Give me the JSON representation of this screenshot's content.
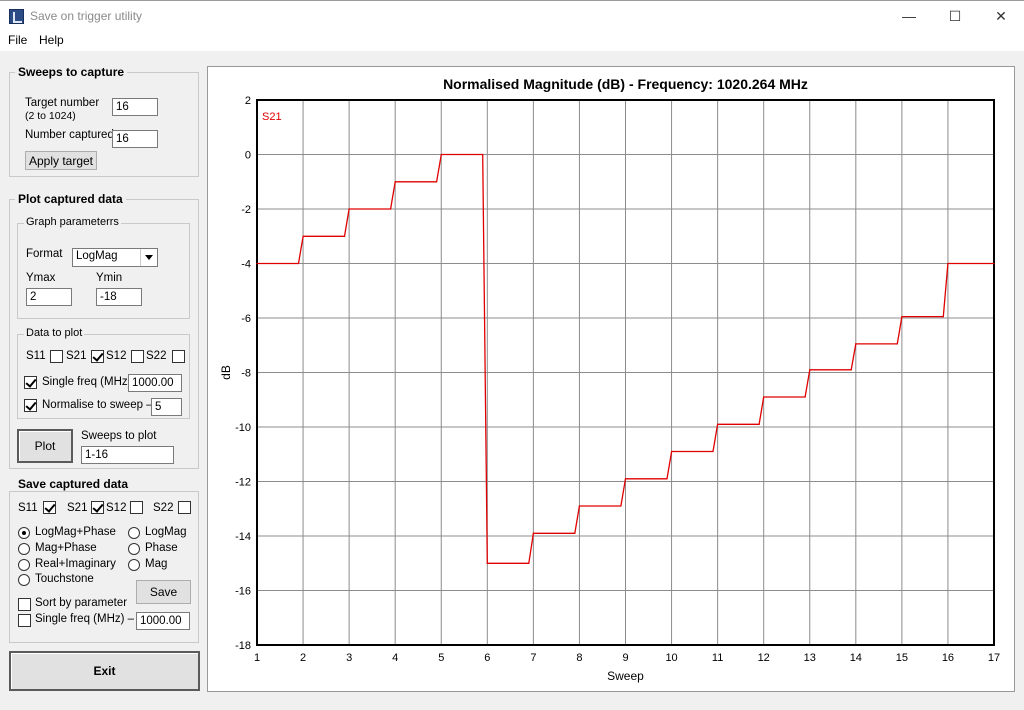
{
  "window": {
    "title": "Save on trigger utility",
    "minimize": "—",
    "maximize": "☐",
    "close": "✕"
  },
  "menu": {
    "file": "File",
    "help": "Help"
  },
  "sweeps": {
    "group_title": "Sweeps to capture",
    "target_label_1": "Target number",
    "target_label_2": "(2 to 1024)",
    "target_value": "16",
    "captured_label": "Number captured",
    "captured_value": "16",
    "apply_button": "Apply target"
  },
  "plot_group": {
    "title": "Plot captured data",
    "graph_params": "Graph parameterrs",
    "format_label": "Format",
    "format_value": "LogMag",
    "ymax_label": "Ymax",
    "ymax_value": "2",
    "ymin_label": "Ymin",
    "ymin_value": "-18",
    "data_to_plot": "Data  to plot",
    "s11": "S11",
    "s21": "S21",
    "s12": "S12",
    "s22": "S22",
    "s11_checked": false,
    "s21_checked": true,
    "s12_checked": false,
    "s22_checked": false,
    "single_freq_label": "Single freq (MHz)",
    "single_freq_value": "1000.00",
    "single_freq_checked": true,
    "normalise_label": "Normalise to sweep –",
    "normalise_value": "5",
    "normalise_checked": true,
    "plot_button": "Plot",
    "sweeps_to_plot_label": "Sweeps to plot",
    "sweeps_to_plot_value": "1-16"
  },
  "save_group": {
    "title": "Save captured data",
    "s11": "S11",
    "s21": "S21",
    "s12": "S12",
    "s22": "S22",
    "s11_checked": true,
    "s21_checked": true,
    "s12_checked": false,
    "s22_checked": false,
    "opt_logmag_phase": "LogMag+Phase",
    "opt_mag_phase": "Mag+Phase",
    "opt_real_imag": "Real+Imaginary",
    "opt_touchstone": "Touchstone",
    "opt_logmag": "LogMag",
    "opt_phase": "Phase",
    "opt_mag": "Mag",
    "selected": "LogMag+Phase",
    "sort_label": "Sort by parameter",
    "single_freq_label": "Single freq (MHz)  –",
    "single_freq_value": "1000.00",
    "save_button": "Save"
  },
  "exit_button": "Exit",
  "chart_data": {
    "type": "line",
    "title": "Normalised Magnitude (dB) - Frequency:  1020.264 MHz",
    "xlabel": "Sweep",
    "ylabel": "dB",
    "xlim": [
      1,
      17
    ],
    "ylim": [
      -18,
      2
    ],
    "xticks": [
      1,
      2,
      3,
      4,
      5,
      6,
      7,
      8,
      9,
      10,
      11,
      12,
      13,
      14,
      15,
      16,
      17
    ],
    "yticks": [
      2,
      0,
      -2,
      -4,
      -6,
      -8,
      -10,
      -12,
      -14,
      -16,
      -18
    ],
    "grid": true,
    "series": [
      {
        "name": "S21",
        "color": "#e00000",
        "points": [
          [
            1,
            -4
          ],
          [
            1.9,
            -4
          ],
          [
            2,
            -3
          ],
          [
            2.9,
            -3
          ],
          [
            3,
            -2
          ],
          [
            3.9,
            -2
          ],
          [
            4,
            -1
          ],
          [
            4.9,
            -1
          ],
          [
            5,
            0
          ],
          [
            5.9,
            0
          ],
          [
            6,
            -15
          ],
          [
            6.9,
            -15
          ],
          [
            7,
            -13.9
          ],
          [
            7.9,
            -13.9
          ],
          [
            8,
            -12.9
          ],
          [
            8.9,
            -12.9
          ],
          [
            9,
            -11.9
          ],
          [
            9.9,
            -11.9
          ],
          [
            10,
            -10.9
          ],
          [
            10.9,
            -10.9
          ],
          [
            11,
            -9.9
          ],
          [
            11.9,
            -9.9
          ],
          [
            12,
            -8.9
          ],
          [
            12.9,
            -8.9
          ],
          [
            13,
            -7.9
          ],
          [
            13.9,
            -7.9
          ],
          [
            14,
            -6.95
          ],
          [
            14.9,
            -6.95
          ],
          [
            15,
            -5.95
          ],
          [
            15.9,
            -5.95
          ],
          [
            16,
            -4
          ],
          [
            17,
            -4
          ]
        ]
      }
    ]
  }
}
